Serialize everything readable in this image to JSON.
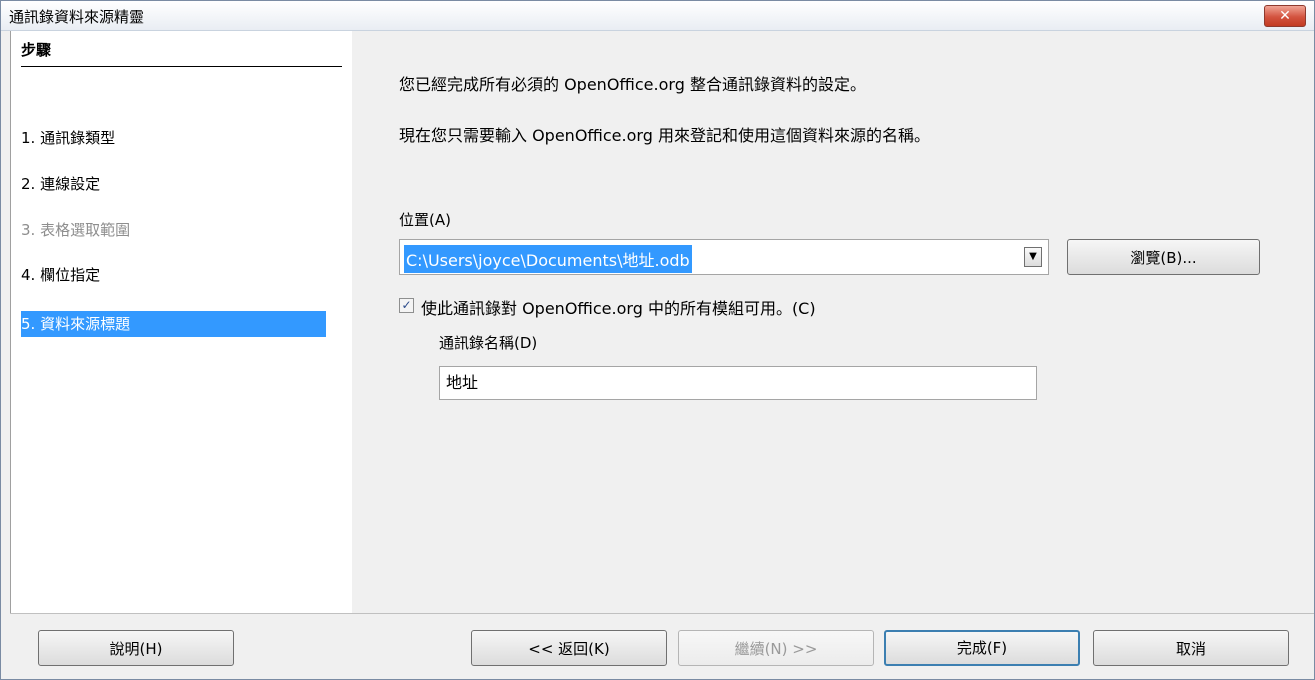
{
  "window": {
    "title": "通訊錄資料來源精靈",
    "close_label": "✕"
  },
  "steps": {
    "header": "步驟",
    "items": [
      {
        "label": "1. 通訊錄類型",
        "state": "normal"
      },
      {
        "label": "2. 連線設定",
        "state": "normal"
      },
      {
        "label": "3. 表格選取範圍",
        "state": "disabled"
      },
      {
        "label": "4. 欄位指定",
        "state": "normal"
      },
      {
        "label": "5. 資料來源標題",
        "state": "selected"
      }
    ]
  },
  "content": {
    "intro1": "您已經完成所有必須的 OpenOffice.org 整合通訊錄資料的設定。",
    "intro2": "現在您只需要輸入 OpenOffice.org 用來登記和使用這個資料來源的名稱。",
    "location_label": "位置(A)",
    "location_value": "C:\\Users\\joyce\\Documents\\地址.odb",
    "browse_label": "瀏覽(B)...",
    "checkbox_label": "使此通訊錄對 OpenOffice.org 中的所有模組可用。(C)",
    "checkbox_checked": true,
    "name_label": "通訊錄名稱(D)",
    "name_value": "地址"
  },
  "footer": {
    "help_label": "說明(H)",
    "back_label": "<< 返回(K)",
    "next_label": "繼續(N) >>",
    "finish_label": "完成(F)",
    "cancel_label": "取消"
  },
  "colors": {
    "selection": "#3399ff",
    "close_button": "#c23b22"
  }
}
